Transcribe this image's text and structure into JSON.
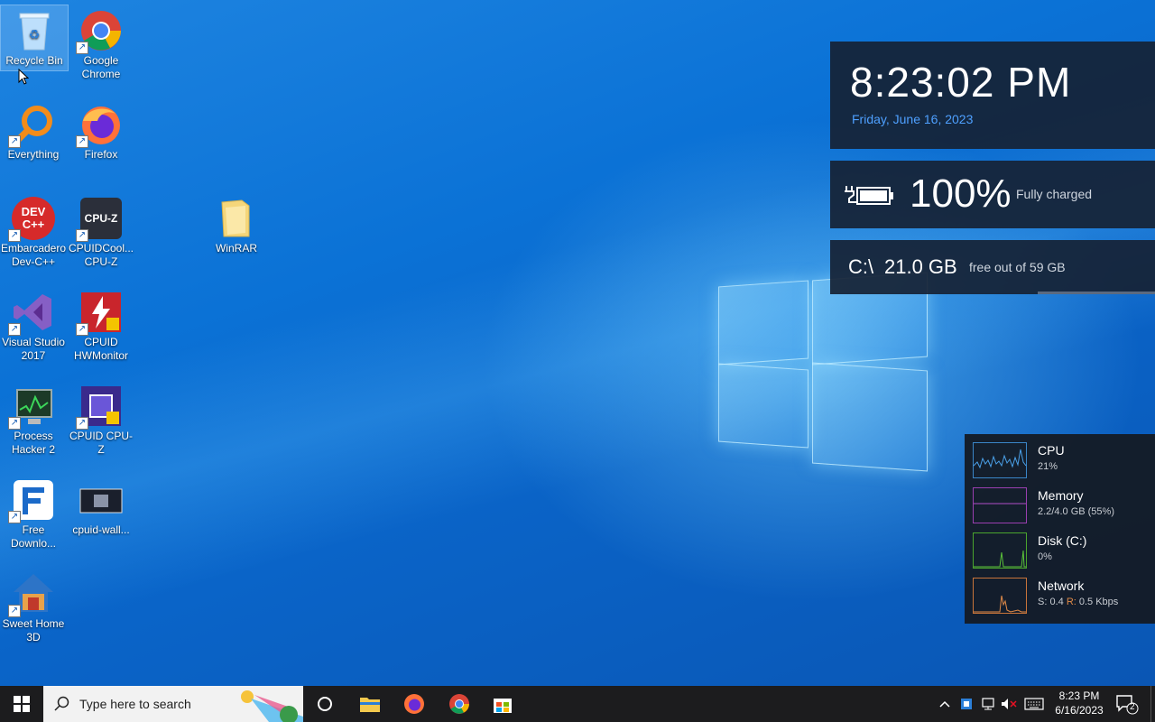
{
  "desktop": {
    "icons": [
      {
        "label": "Recycle Bin"
      },
      {
        "label": "Google Chrome"
      },
      {
        "label": "Everything"
      },
      {
        "label": "Firefox"
      },
      {
        "label": "Embarcadero Dev-C++"
      },
      {
        "label": "CPUIDCool... CPU-Z"
      },
      {
        "label": "WinRAR"
      },
      {
        "label": "Visual Studio 2017"
      },
      {
        "label": "CPUID HWMonitor"
      },
      {
        "label": "Process Hacker 2"
      },
      {
        "label": "CPUID CPU-Z"
      },
      {
        "label": "Free Downlo..."
      },
      {
        "label": "cpuid-wall..."
      },
      {
        "label": "Sweet Home 3D"
      }
    ],
    "devcpp_icon_text": "DEV C++",
    "cpuz_icon_text": "CPU-Z"
  },
  "clock_widget": {
    "time": "8:23:02 PM",
    "date": "Friday, June 16, 2023"
  },
  "battery_widget": {
    "percent": "100%",
    "status": "Fully charged"
  },
  "disk_widget": {
    "drive": "C:\\",
    "free": "21.0 GB",
    "total": "free out of 59 GB"
  },
  "perf_monitor": {
    "items": [
      {
        "name": "CPU",
        "value": "21%",
        "color": "#3a86c8"
      },
      {
        "name": "Memory",
        "value": "2.2/4.0 GB (55%)",
        "color": "#9a3fb0"
      },
      {
        "name": "Disk (C:)",
        "value": "0%",
        "color": "#4aa52e"
      },
      {
        "name": "Network",
        "value_s": "S: 0.4",
        "value_r": "R:",
        "value_rest": "0.5 Kbps",
        "color": "#c8743a"
      }
    ]
  },
  "taskbar": {
    "search_placeholder": "Type here to search",
    "tray_time": "8:23 PM",
    "tray_date": "6/16/2023",
    "notification_count": "2"
  }
}
